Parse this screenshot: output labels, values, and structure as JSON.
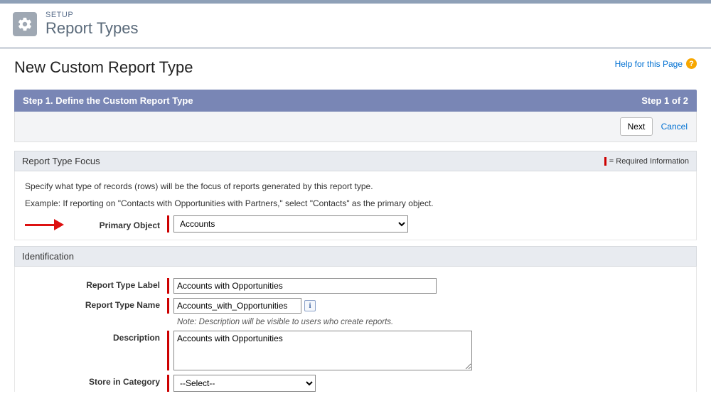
{
  "header": {
    "eyebrow": "SETUP",
    "title": "Report Types"
  },
  "page": {
    "title": "New Custom Report Type",
    "help": "Help for this Page"
  },
  "step": {
    "title": "Step 1. Define the Custom Report Type",
    "progress": "Step 1 of 2"
  },
  "actions": {
    "next": "Next",
    "cancel": "Cancel"
  },
  "focus": {
    "heading": "Report Type Focus",
    "required_note": "= Required Information",
    "line1": "Specify what type of records (rows) will be the focus of reports generated by this report type.",
    "line2": "Example: If reporting on \"Contacts with Opportunities with Partners,\" select \"Contacts\" as the primary object.",
    "primary_label": "Primary Object",
    "primary_value": "Accounts"
  },
  "ident": {
    "heading": "Identification",
    "label_label": "Report Type Label",
    "label_value": "Accounts with Opportunities",
    "name_label": "Report Type Name",
    "name_value": "Accounts_with_Opportunities",
    "desc_note": "Note: Description will be visible to users who create reports.",
    "desc_label": "Description",
    "desc_value": "Accounts with Opportunities",
    "cat_label": "Store in Category",
    "cat_value": "--Select--"
  }
}
